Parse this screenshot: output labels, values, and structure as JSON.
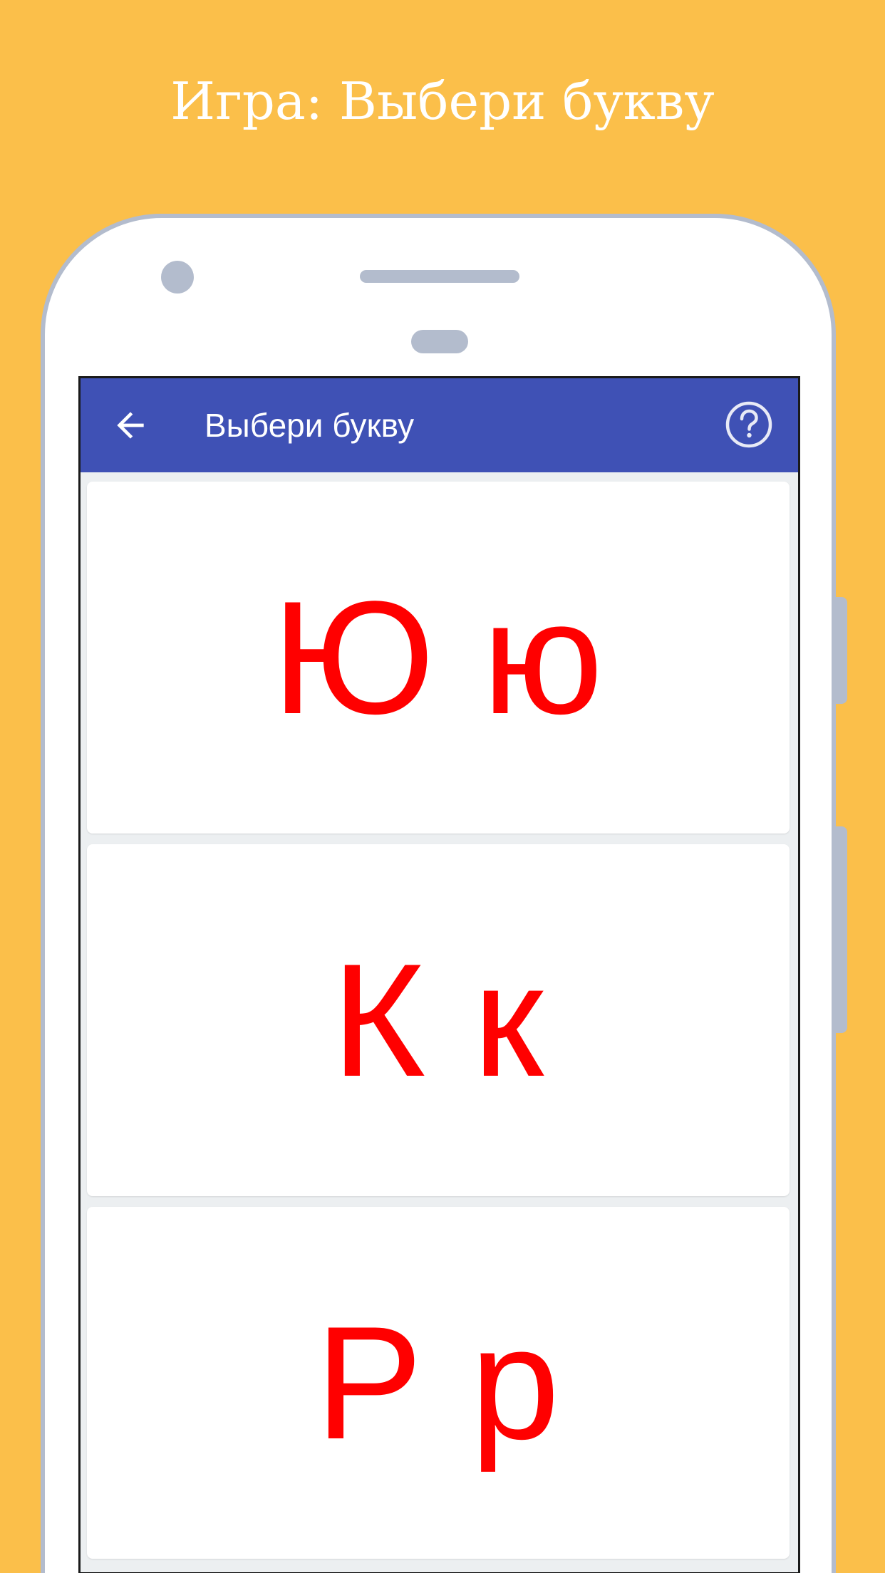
{
  "promo": {
    "title": "Игра: Выбери букву"
  },
  "app": {
    "toolbar": {
      "title": "Выбери букву",
      "back_icon": "arrow-left-icon",
      "help_icon": "help-circle-icon"
    },
    "cards": [
      {
        "letters": "Ю ю"
      },
      {
        "letters": "К к"
      },
      {
        "letters": "Р р"
      }
    ]
  },
  "colors": {
    "background": "#FBBF4A",
    "toolbar": "#3F51B5",
    "letter": "#FF0000",
    "phone_frame": "#B3BCCD",
    "screen_bg": "#ECEFF1"
  }
}
